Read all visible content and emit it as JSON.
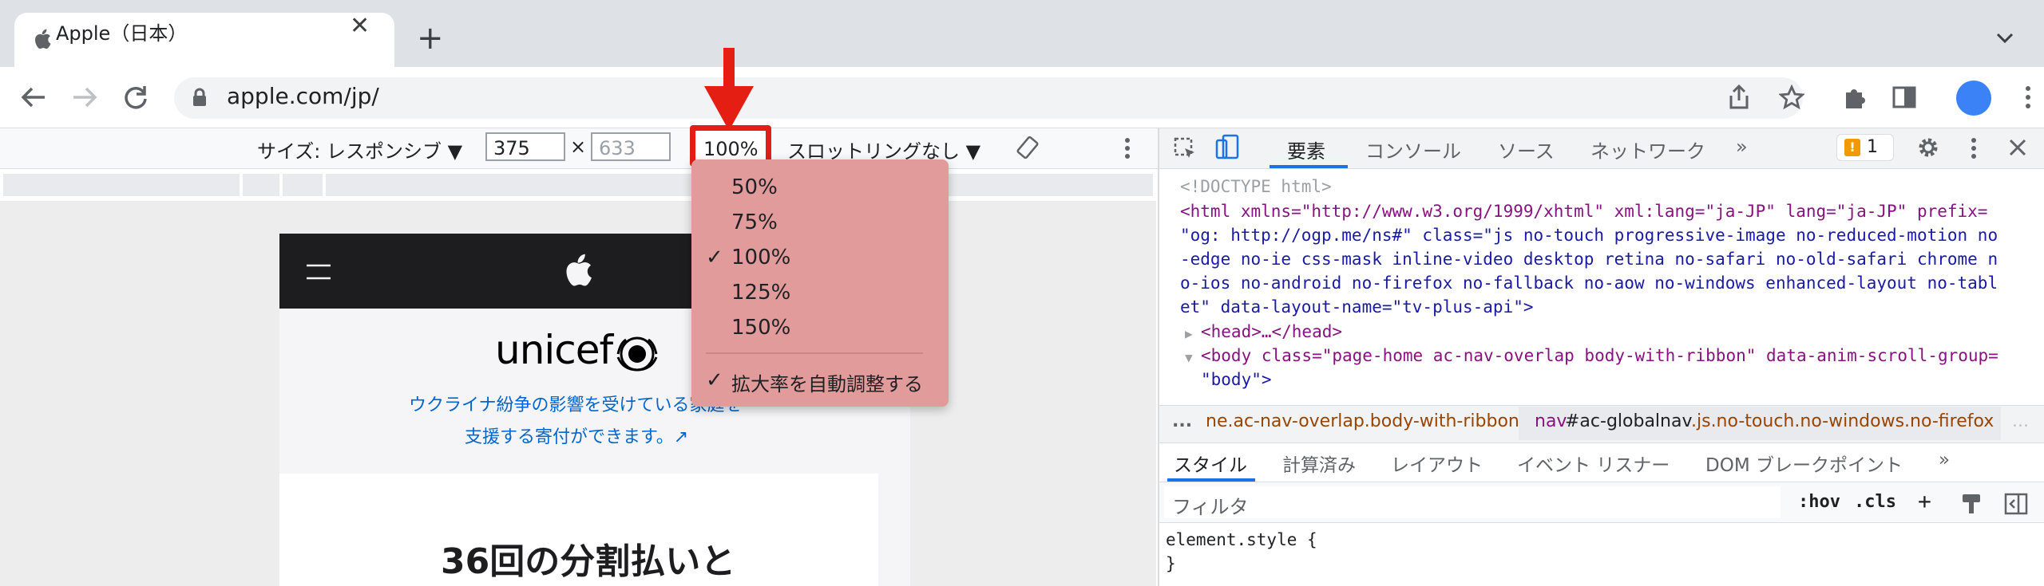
{
  "browser": {
    "tab_title": "Apple（日本）",
    "tab_close": "✕",
    "new_tab": "+",
    "tab_list": "⌄",
    "url": "apple.com/jp/"
  },
  "device_toolbar": {
    "size_label": "サイズ: レスポンシブ ▼",
    "width_value": "375",
    "times": "×",
    "height_value": "633",
    "zoom_value": "100%",
    "zoom_caret": "▼",
    "throttle": "スロットリングなし ▼"
  },
  "zoom_menu": {
    "items": [
      "50%",
      "75%",
      "100%",
      "125%",
      "150%"
    ],
    "checked": "100%",
    "auto_label": "拡大率を自動調整する",
    "check": "✓"
  },
  "page": {
    "unicef": "unicef",
    "ukraine_line1": "ウクライナ紛争の影響を受けている家庭を",
    "ukraine_line2": "支援する寄付ができます。↗",
    "heading": "36回の分割払いと"
  },
  "devtools": {
    "tabs": [
      "要素",
      "コンソール",
      "ソース",
      "ネットワーク",
      "»"
    ],
    "issues_count": "1",
    "dom": {
      "doctype": "<!DOCTYPE html>",
      "html_line1": "<html xmlns=\"http://www.w3.org/1999/xhtml\" xml:lang=\"ja-JP\" lang=\"ja-JP\" prefix=",
      "html_line2": "\"og: http://ogp.me/ns#\" class=\"js no-touch progressive-image no-reduced-motion no",
      "html_line3": "-edge no-ie css-mask inline-video desktop retina no-safari no-old-safari chrome n",
      "html_line4": "o-ios no-android no-firefox no-fallback no-aow no-windows enhanced-layout no-tabl",
      "html_line5": "et\" data-layout-name=\"tv-plus-api\">",
      "head": "<head>…</head>",
      "body_line1": "<body class=\"page-home ac-nav-overlap body-with-ribbon\" data-anim-scroll-group=",
      "body_line2": "\"body\">"
    },
    "breadcrumb": {
      "ellipsis": "...",
      "crumb1": "ne.ac-nav-overlap.body-with-ribbon",
      "crumb2_tag": "nav",
      "crumb2_id": "#ac-globalnav",
      "crumb2_cls": ".js.no-touch.no-windows.no-firefox",
      "more": "..."
    },
    "subtabs": [
      "スタイル",
      "計算済み",
      "レイアウト",
      "イベント リスナー",
      "DOM ブレークポイント",
      "»"
    ],
    "filter_placeholder": "フィルタ",
    "hov": ":hov",
    "cls": ".cls",
    "plus": "+",
    "element_style_line1": "element.style {",
    "element_style_line2": "}"
  },
  "colors": {
    "highlight_red": "#e41e13",
    "menu_bg": "#e19b9b",
    "active_blue": "#1a73e8"
  }
}
